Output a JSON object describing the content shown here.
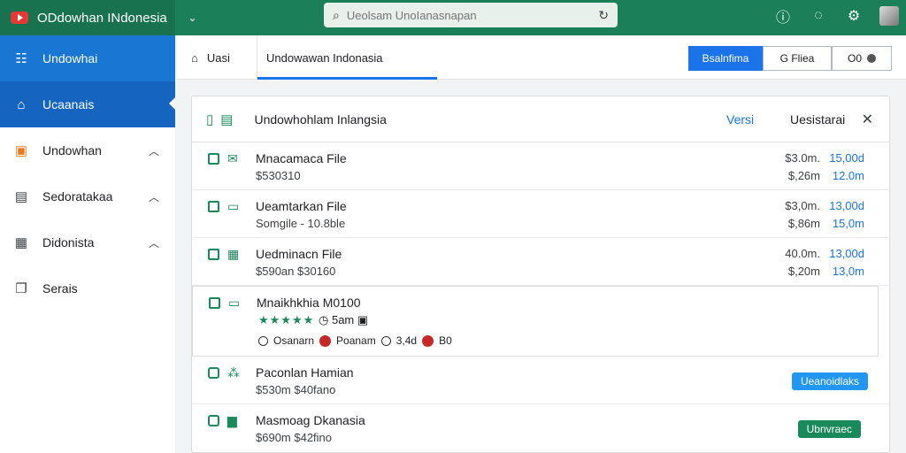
{
  "app": {
    "title": "ODdowhan INdonesia"
  },
  "search": {
    "placeholder": "Ueolsam UnoIanasnapan"
  },
  "sidebar": {
    "items": [
      {
        "label": "Undowhai",
        "icon": "grid-icon"
      },
      {
        "label": "Ucaanais",
        "icon": "home-icon"
      },
      {
        "label": "Undowhan",
        "icon": "document-icon"
      },
      {
        "label": "Sedoratakaa",
        "icon": "list-icon"
      },
      {
        "label": "Didonista",
        "icon": "calendar-icon"
      },
      {
        "label": "Serais",
        "icon": "folder-icon"
      }
    ]
  },
  "tabs": {
    "home_label": "Uasi",
    "active_label": "Undowawan Indonasia"
  },
  "segmented": {
    "btn1": "Bsalnfima",
    "btn2": "G Fliea",
    "btn3": "O0"
  },
  "panel": {
    "title": "Undowhohlam Inlangsia",
    "link": "Versi",
    "label": "Uesistarai"
  },
  "rows": [
    {
      "name": "Mnacamaca File",
      "sub": "$530310",
      "v1a": "$3.0m.",
      "v2a": "15,00d",
      "v1b": "$,26m",
      "v2b": "12.0m"
    },
    {
      "name": "Ueamtarkan File",
      "sub": "Somgile - 10.8ble",
      "v1a": "$3,0m.",
      "v2a": "13,00d",
      "v1b": "$,86m",
      "v2b": "15,0m"
    },
    {
      "name": "Uedminacn File",
      "sub": "$590an $30160",
      "v1a": "40.0m.",
      "v2a": "13,00d",
      "v1b": "$,20m",
      "v2b": "13,0m"
    }
  ],
  "expanded": {
    "name": "Mnaikhkhia M0100",
    "stars": "★★★★★",
    "meta": "5am",
    "chip1": "Osanarn",
    "chip2": "Poanam",
    "chip3": "3,4d",
    "chip4": "B0"
  },
  "rows2": [
    {
      "name": "Paconlan Hamian",
      "sub": "$530m $40fano",
      "button": "Ueanoidlaks"
    },
    {
      "name": "Masmoag Dkanasia",
      "sub": "$690m $42fino",
      "button": "Ubnvraec"
    }
  ]
}
